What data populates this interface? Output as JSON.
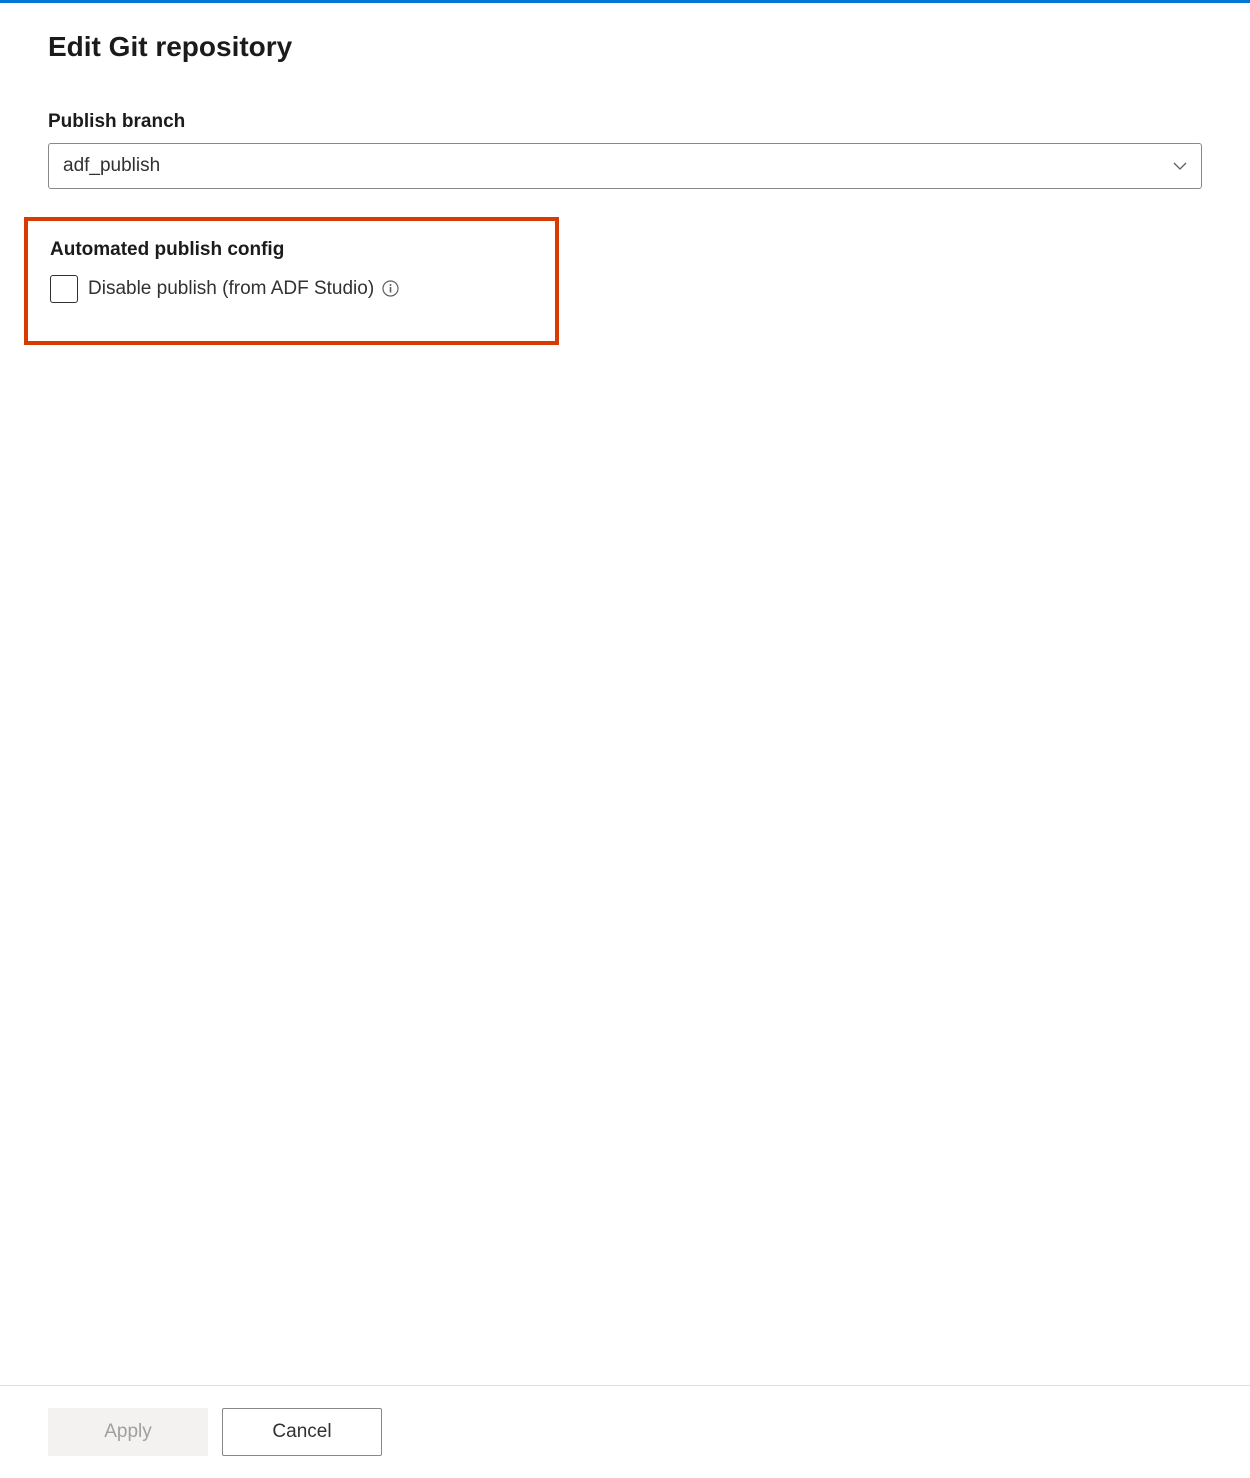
{
  "header": {
    "title": "Edit Git repository"
  },
  "fields": {
    "publish_branch": {
      "label": "Publish branch",
      "value": "adf_publish"
    },
    "automated_publish": {
      "label": "Automated publish config",
      "checkbox_label": "Disable publish (from ADF Studio)",
      "checked": false
    }
  },
  "footer": {
    "apply_label": "Apply",
    "cancel_label": "Cancel"
  }
}
